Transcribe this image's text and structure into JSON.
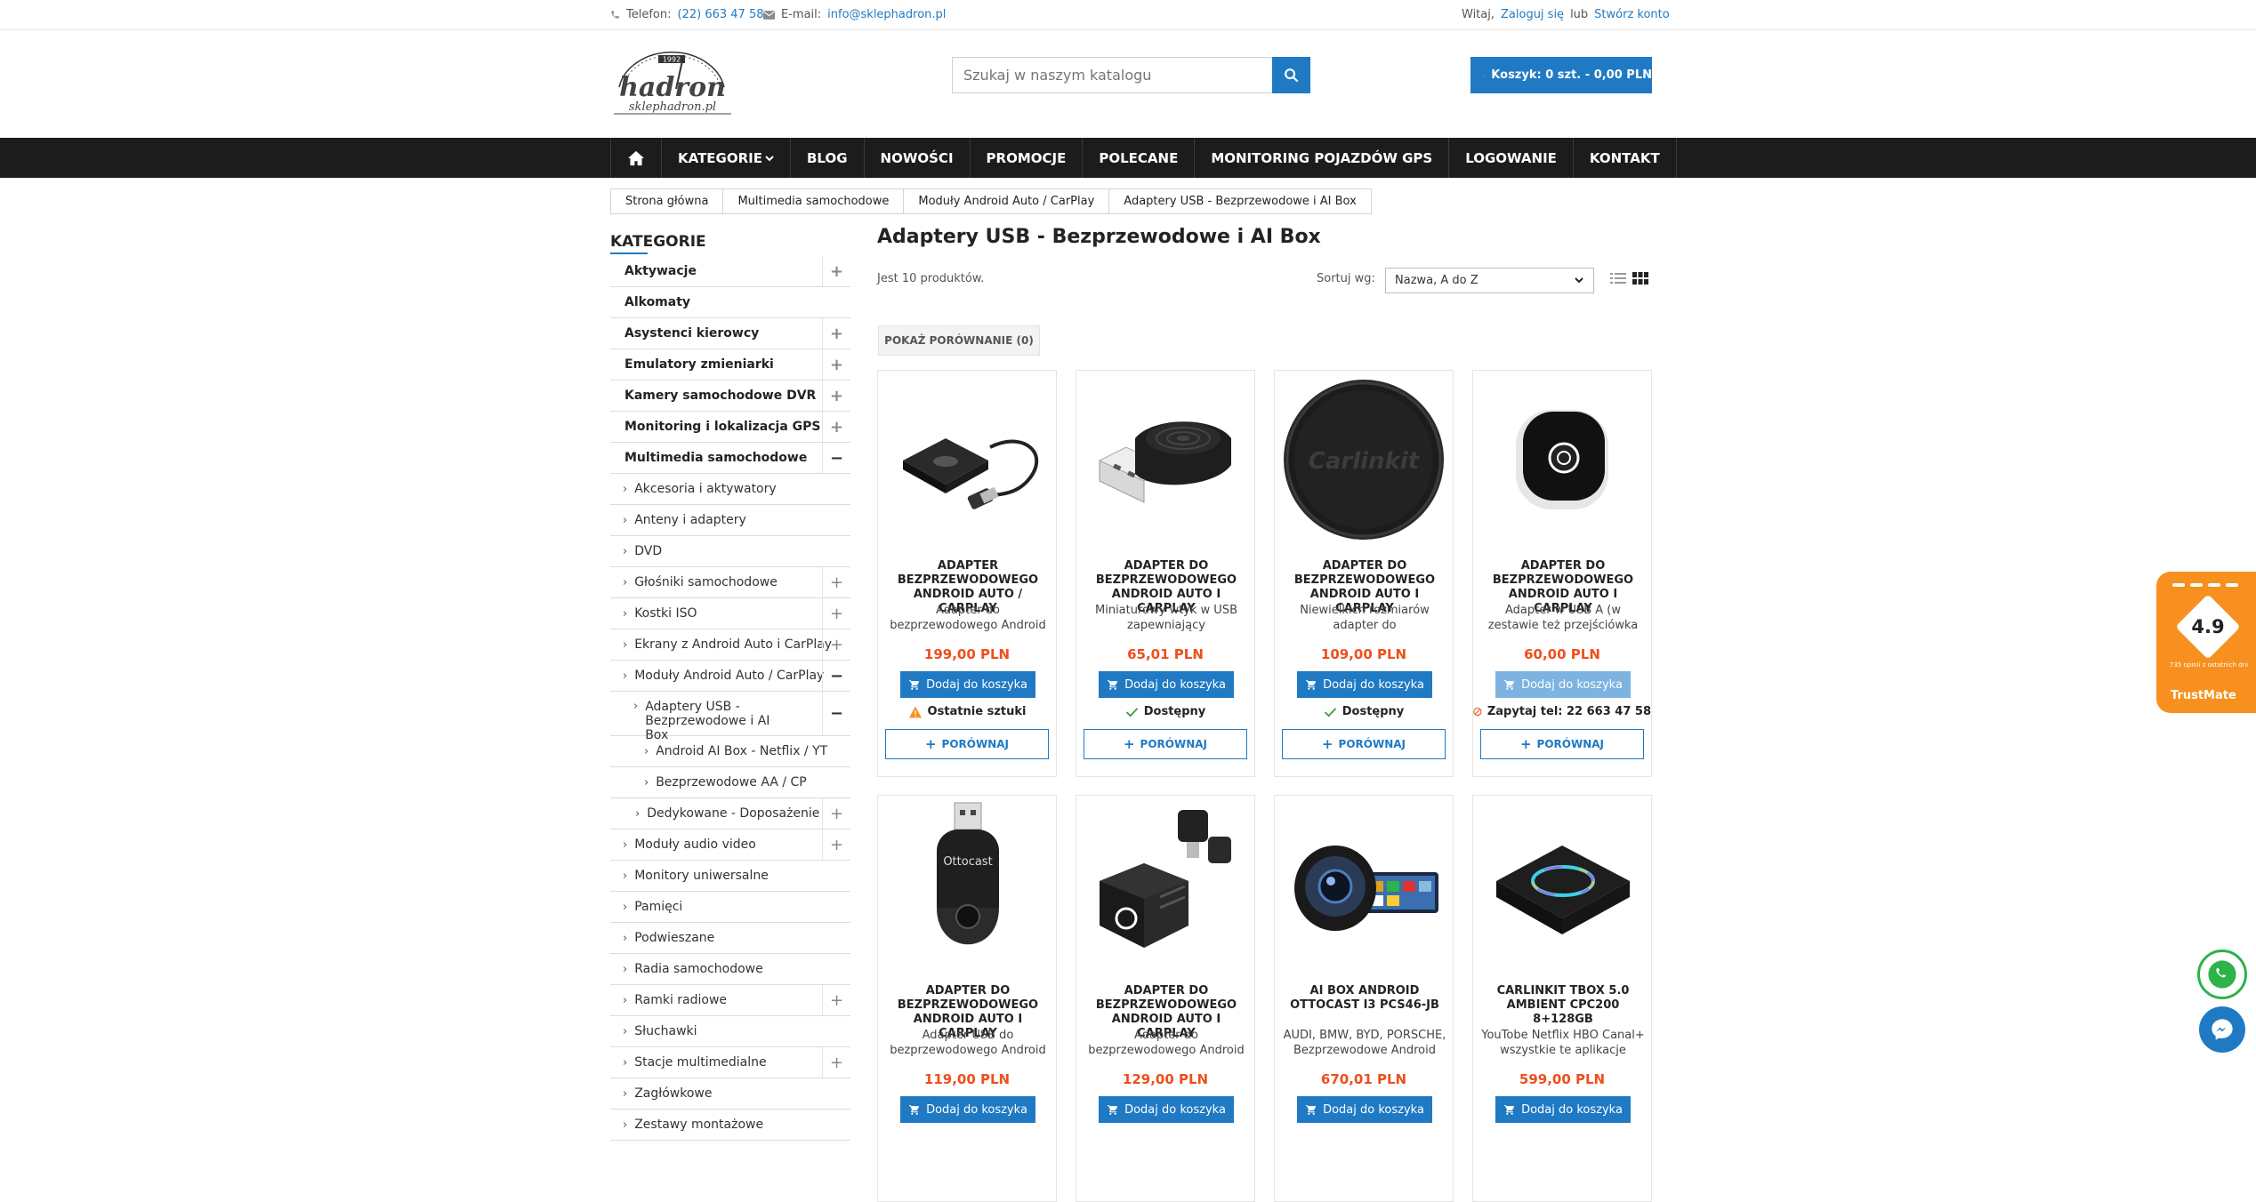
{
  "topbar": {
    "phone_label": "Telefon:",
    "phone": "(22) 663 47 58",
    "email_label": "E-mail:",
    "email": "info@sklephadron.pl",
    "greeting": "Witaj,",
    "login": "Zaloguj się",
    "or": "lub",
    "register": "Stwórz konto"
  },
  "logo": {
    "brand": "hadron",
    "domain": "sklephadron.pl",
    "year": "1992"
  },
  "search": {
    "placeholder": "Szukaj w naszym katalogu"
  },
  "cart": {
    "label": "Koszyk: 0 szt. - 0,00 PLN"
  },
  "nav": {
    "items": [
      "KATEGORIE",
      "BLOG",
      "NOWOŚCI",
      "PROMOCJE",
      "POLECANE",
      "MONITORING POJAZDÓW GPS",
      "LOGOWANIE",
      "KONTAKT"
    ]
  },
  "breadcrumb": [
    "Strona główna",
    "Multimedia samochodowe",
    "Moduły Android Auto / CarPlay",
    "Adaptery USB - Bezprzewodowe i AI Box"
  ],
  "sidebar": {
    "title": "KATEGORIE",
    "items": [
      "Aktywacje",
      "Alkomaty",
      "Asystenci kierowcy",
      "Emulatory zmieniarki",
      "Kamery samochodowe DVR",
      "Monitoring i lokalizacja GPS",
      "Multimedia samochodowe",
      "Akcesoria i aktywatory",
      "Anteny i adaptery",
      "DVD",
      "Głośniki samochodowe",
      "Kostki ISO",
      "Ekrany z Android Auto i CarPlay",
      "Moduły Android Auto / CarPlay",
      "Adaptery USB - Bezprzewodowe i AI Box",
      "Android AI Box - Netflix / YT",
      "Bezprzewodowe AA / CP",
      "Dedykowane - Doposażenie",
      "Moduły audio video",
      "Monitory uniwersalne",
      "Pamięci",
      "Podwieszane",
      "Radia samochodowe",
      "Ramki radiowe",
      "Słuchawki",
      "Stacje multimedialne",
      "Zagłówkowe",
      "Zestawy montażowe"
    ]
  },
  "main": {
    "title": "Adaptery USB - Bezprzewodowe i AI Box",
    "count": "Jest 10 produktów.",
    "sort_label": "Sortuj wg:",
    "sort_value": "Nazwa, A do Z",
    "compare_button": "POKAŻ PORÓWNANIE (0)"
  },
  "product_labels": {
    "add": "Dodaj do koszyka",
    "compare": "PORÓWNAJ"
  },
  "products": [
    {
      "name": "ADAPTER BEZPRZEWODOWEGO ANDROID AUTO / CARPLAY",
      "desc": "Adapter do bezprzewodowego Android",
      "price": "199,00 PLN",
      "availability": "Ostatnie sztuki"
    },
    {
      "name": "ADAPTER DO BEZPRZEWODOWEGO ANDROID AUTO I CARPLAY",
      "desc": "Miniaturowy wtyk w USB zapewniający",
      "price": "65,01 PLN",
      "availability": "Dostępny"
    },
    {
      "name": "ADAPTER DO BEZPRZEWODOWEGO ANDROID AUTO I CARPLAY",
      "desc": "Niewielkich rozmiarów adapter do",
      "price": "109,00 PLN",
      "availability": "Dostępny"
    },
    {
      "name": "ADAPTER DO BEZPRZEWODOWEGO ANDROID AUTO I CARPLAY",
      "desc": "Adapter w USB A (w zestawie też przejściówka",
      "price": "60,00 PLN",
      "availability": "Zapytaj tel: 22 663 47 58"
    },
    {
      "name": "ADAPTER DO BEZPRZEWODOWEGO ANDROID AUTO I CARPLAY",
      "desc": "Adapter USB do bezprzewodowego Android",
      "price": "119,00 PLN",
      "availability": ""
    },
    {
      "name": "ADAPTER DO BEZPRZEWODOWEGO ANDROID AUTO I CARPLAY",
      "desc": "Adapter do bezprzewodowego Android",
      "price": "129,00 PLN",
      "availability": ""
    },
    {
      "name": "AI BOX ANDROID OTTOCAST I3 PCS46-JB",
      "desc": "AUDI, BMW, BYD, PORSCHE, Bezprzewodowe Android",
      "price": "670,01 PLN",
      "availability": ""
    },
    {
      "name": "CARLINKIT TBOX 5.0 AMBIENT CPC200 8+128GB",
      "desc": "YouTobe Netflix HBO Canal+ wszystkie te aplikacje",
      "price": "599,00 PLN",
      "availability": ""
    }
  ],
  "trustmate": {
    "rating": "4.9",
    "reviews": "735 opinii z ostatnich dni",
    "brand": "TrustMate"
  },
  "colors": {
    "accent": "#1f7ac3",
    "price": "#ee4f1c",
    "nav_bg": "#1c1c1c",
    "trust": "#f7901e"
  }
}
